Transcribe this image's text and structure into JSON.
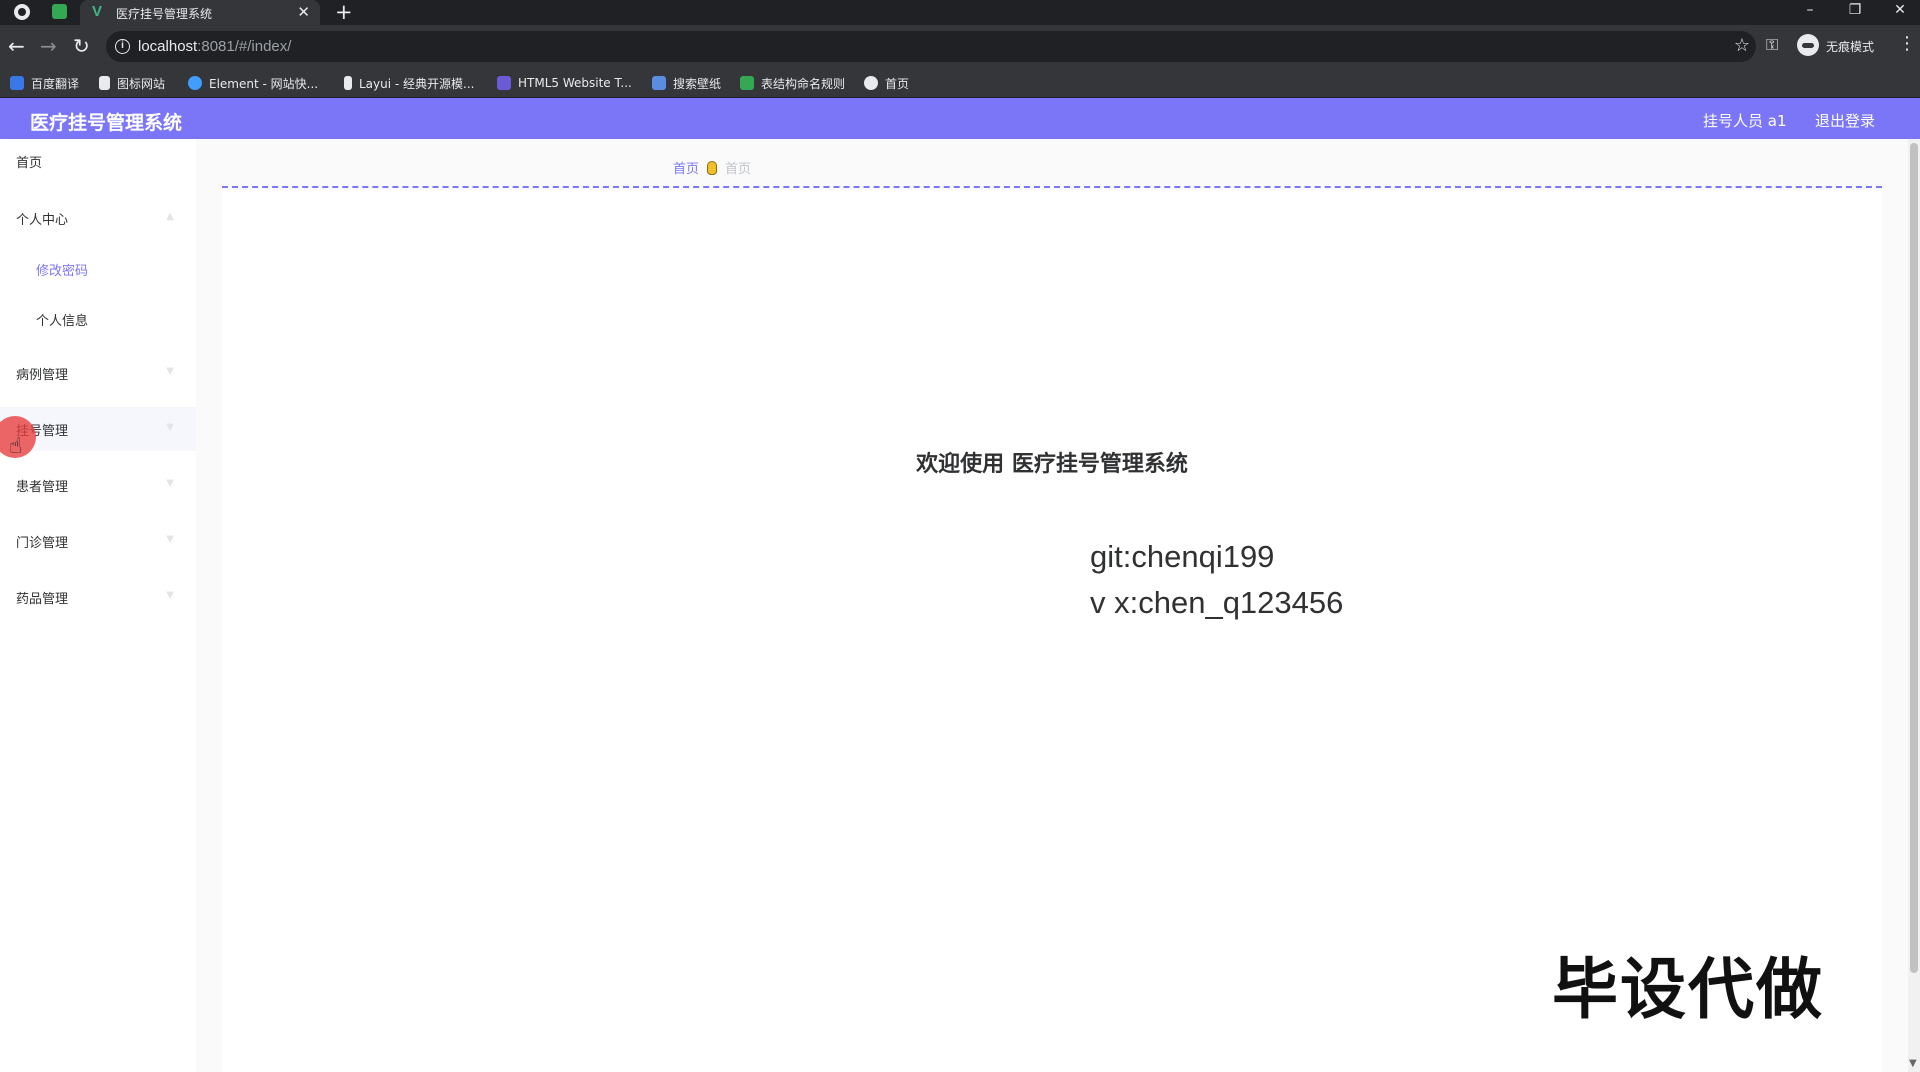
{
  "browser": {
    "tab_title": "医疗挂号管理系统",
    "tab_close": "✕",
    "new_tab": "+",
    "url_host": "localhost",
    "url_rest": ":8081/#/index/",
    "incognito_label": "无痕模式",
    "window_controls": [
      "–",
      "❐",
      "✕"
    ],
    "bookmarks": [
      {
        "label": "百度翻译",
        "icon": "translate-icon",
        "color": "#3b78e7"
      },
      {
        "label": "图标网站",
        "icon": "flag-icon",
        "color": "#e8eaed"
      },
      {
        "label": "Element - 网站快...",
        "icon": "element-icon",
        "color": "#409eff"
      },
      {
        "label": "Layui - 经典开源模...",
        "icon": "layui-icon",
        "color": "#e8eaed"
      },
      {
        "label": "HTML5 Website T...",
        "icon": "html5-icon",
        "color": "#6b5bd6"
      },
      {
        "label": "搜索壁纸",
        "icon": "wallpaper-icon",
        "color": "#5a8de0"
      },
      {
        "label": "表结构命名规则",
        "icon": "sheet-icon",
        "color": "#34a853"
      },
      {
        "label": "首页",
        "icon": "globe-icon",
        "color": "#e8eaed"
      }
    ]
  },
  "header": {
    "title": "医疗挂号管理系统",
    "user": "挂号人员 a1",
    "logout": "退出登录",
    "color": "#7b76f7"
  },
  "sidebar": {
    "items": [
      {
        "label": "首页"
      },
      {
        "label": "个人中心"
      },
      {
        "label": "修改密码"
      },
      {
        "label": "个人信息"
      },
      {
        "label": "病例管理"
      },
      {
        "label": "挂号管理"
      },
      {
        "label": "患者管理"
      },
      {
        "label": "门诊管理"
      },
      {
        "label": "药品管理"
      }
    ]
  },
  "breadcrumb": {
    "home": "首页",
    "current": "首页"
  },
  "main": {
    "welcome": "欢迎使用 医疗挂号管理系统",
    "contact_git": "git:chenqi199",
    "contact_wx": "v x:chen_q123456"
  },
  "watermark": "毕设代做"
}
